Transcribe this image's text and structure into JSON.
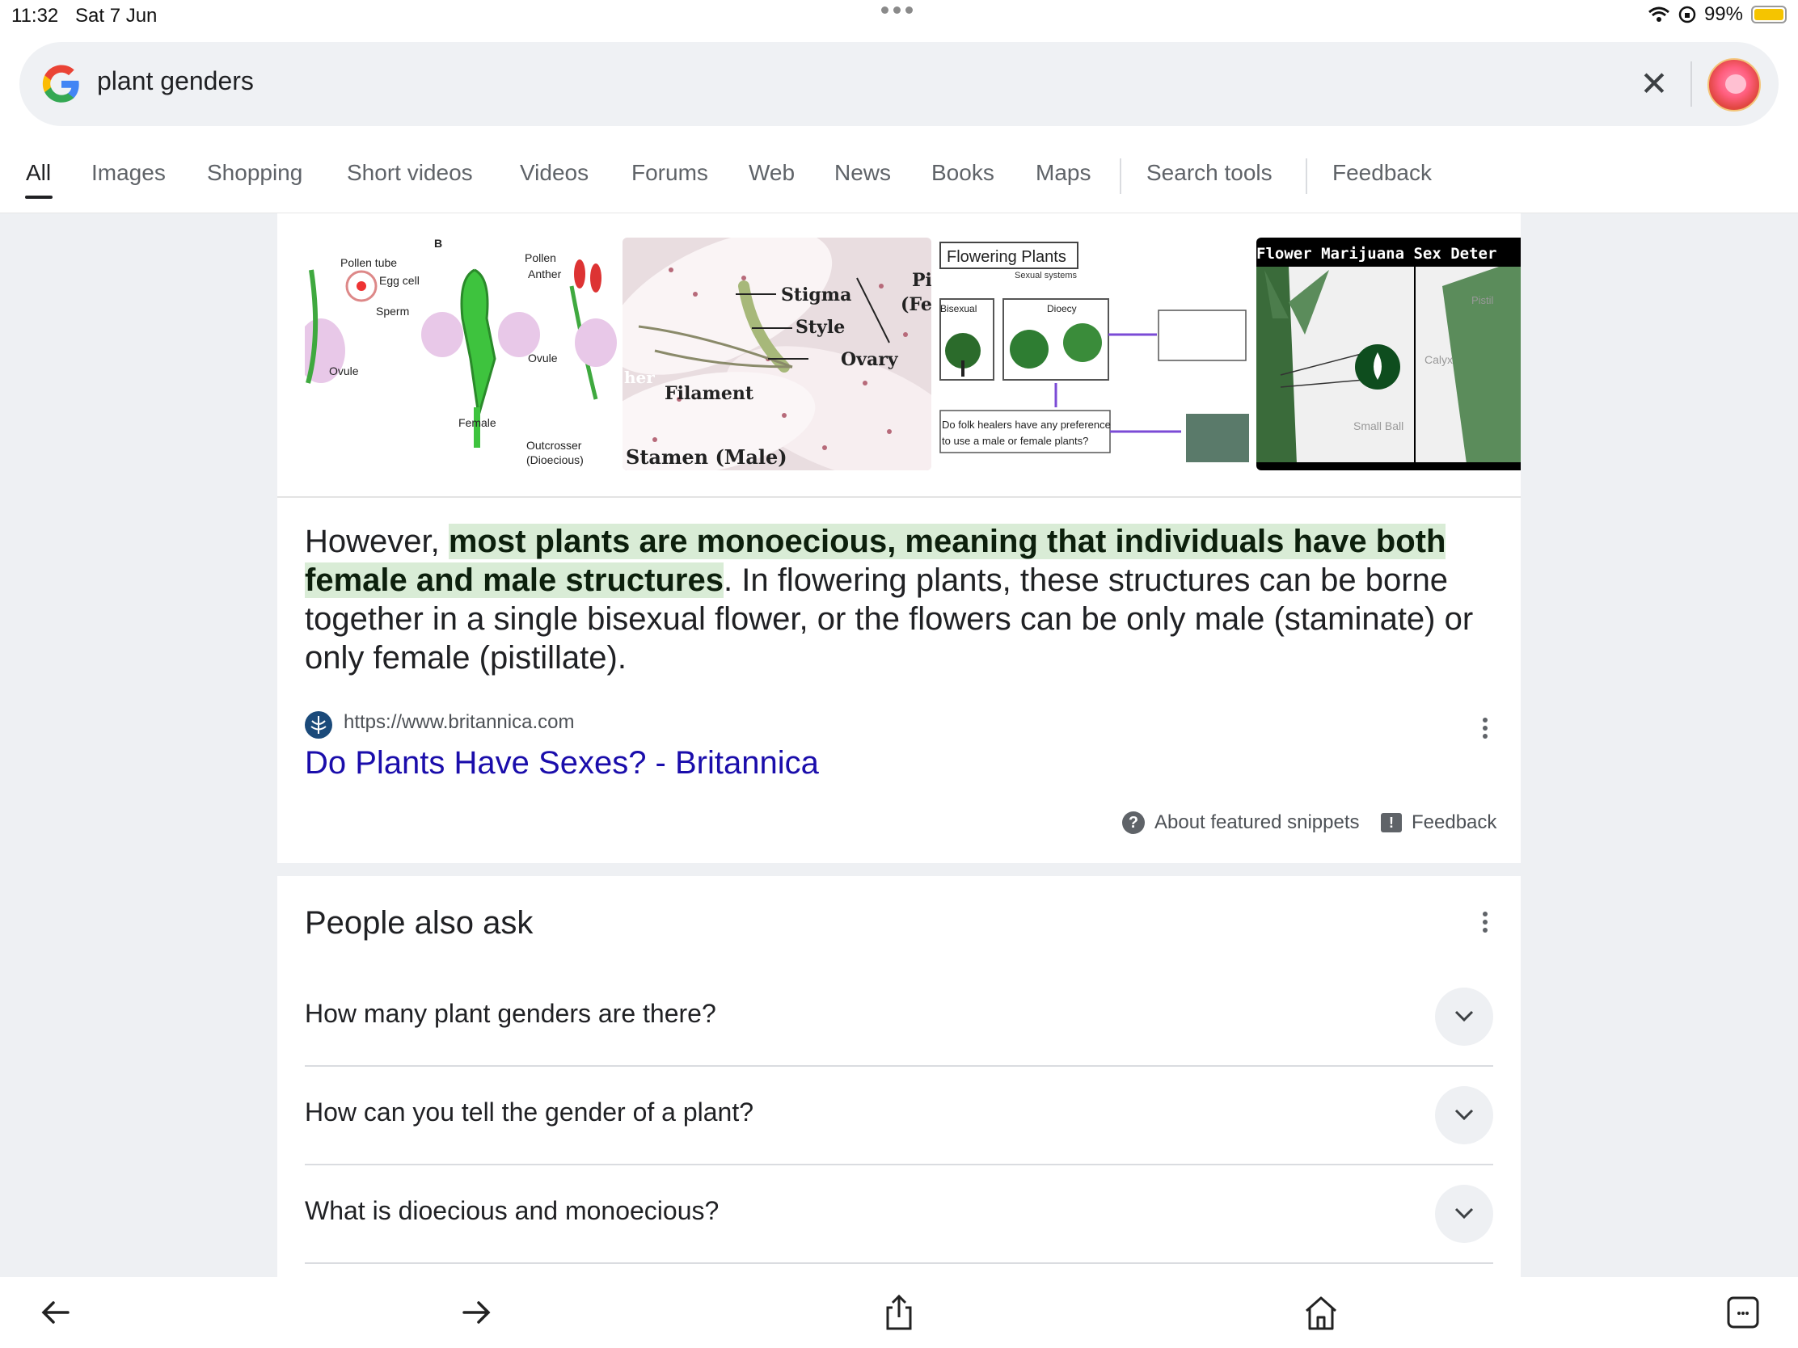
{
  "status": {
    "time": "11:32",
    "date": "Sat 7 Jun",
    "battery": "99%"
  },
  "search": {
    "query": "plant genders"
  },
  "tabs": [
    "All",
    "Images",
    "Shopping",
    "Short videos",
    "Videos",
    "Forums",
    "Web",
    "News",
    "Books",
    "Maps",
    "Search tools",
    "Feedback"
  ],
  "images": [
    {
      "labels": [
        "Pollen tube",
        "Egg cell",
        "Sperm",
        "Ovule",
        "Pollen",
        "Anther",
        "Ovule",
        "Female",
        "Outcrosser",
        "(Dioecious)",
        "B"
      ]
    },
    {
      "labels": [
        "Stigma",
        "Style",
        "Ovary",
        "Filament",
        "Stamen (Male)",
        "Pi",
        "(Fen",
        "her"
      ]
    },
    {
      "labels": [
        "Flowering Plants",
        "Sexual systems",
        "Bisexual",
        "Dioecy",
        "Do folk healers have any preference",
        "to use a male or female plants?"
      ]
    },
    {
      "labels": [
        "Flower Marijuana Sex Deter",
        "Pistil",
        "Calyx",
        "Small Ball"
      ]
    }
  ],
  "snippet": {
    "pre": "However, ",
    "highlight": "most plants are monoecious, meaning that individuals have both female and male structures",
    "post": ". In flowering plants, these structures can be borne together in a single bisexual flower, or the flowers can be only male (staminate) or only female (pistillate).",
    "url": "https://www.britannica.com",
    "title": "Do Plants Have Sexes? - Britannica",
    "about_label": "About featured snippets",
    "feedback_label": "Feedback"
  },
  "paa": {
    "title": "People also ask",
    "questions": [
      "How many plant genders are there?",
      "How can you tell the gender of a plant?",
      "What is dioecious and monoecious?"
    ]
  },
  "icons": {
    "back": "arrow-left-icon",
    "forward": "arrow-right-icon",
    "share": "share-icon",
    "home": "home-icon",
    "tabs": "tabs-icon"
  },
  "colors": {
    "link": "#1a0dab",
    "highlight": "#d9ecd6",
    "battery": "#f5c400"
  }
}
